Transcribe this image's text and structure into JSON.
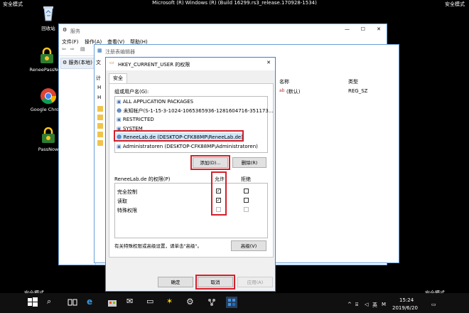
{
  "screen": {
    "safe_mode": "安全模式",
    "build_title": "Microsoft (R) Windows (R) (Build 16299.rs3_release.170928-1534)"
  },
  "desktop_icons": [
    {
      "label": "回收站"
    },
    {
      "label": "ReneePassNow"
    },
    {
      "label": "Google Chrome"
    },
    {
      "label": "PassNow"
    }
  ],
  "services_window": {
    "title": "服务",
    "menu": [
      "文件(F)",
      "操作(A)",
      "查看(V)",
      "帮助(H)"
    ],
    "tree_item": "服务(本地)"
  },
  "regedit_window": {
    "title": "注册表编辑器",
    "col_name": "名称",
    "col_type": "类型",
    "row_name": "(默认)",
    "row_type": "REG_SZ",
    "side_labels": [
      "文",
      "计",
      "H",
      "H"
    ]
  },
  "dialog": {
    "title": "HKEY_CURRENT_USER 的权限",
    "tab": "安全",
    "group_label": "组或用户名(G):",
    "users": [
      "ALL APPLICATION PACKAGES",
      "未知帐户(S-1-15-3-1024-1065365936-1281604716-351173...",
      "RESTRICTED",
      "SYSTEM",
      "ReneeLab.de (DESKTOP-CFK88MP\\ReneeLab.de)",
      "Administratoren (DESKTOP-CFK88MP\\Administratoren)"
    ],
    "add_button": "添加(D)...",
    "remove_button": "删除(R)",
    "perm_label": "ReneeLab.de 的权限(P)",
    "allow_header": "允许",
    "deny_header": "拒绝",
    "permissions": [
      {
        "name": "完全控制",
        "allow": true,
        "deny": false
      },
      {
        "name": "读取",
        "allow": true,
        "deny": false
      },
      {
        "name": "特殊权限",
        "allow": false,
        "deny": false
      }
    ],
    "advanced_text": "有关特殊权限或高级设置，请单击\"高级\"。",
    "advanced_button": "高级(V)",
    "ok": "确定",
    "cancel": "取消",
    "apply": "应用(A)"
  },
  "taskbar": {
    "time": "15:24",
    "date": "2019/6/20",
    "ime": "M",
    "lang": "英"
  }
}
